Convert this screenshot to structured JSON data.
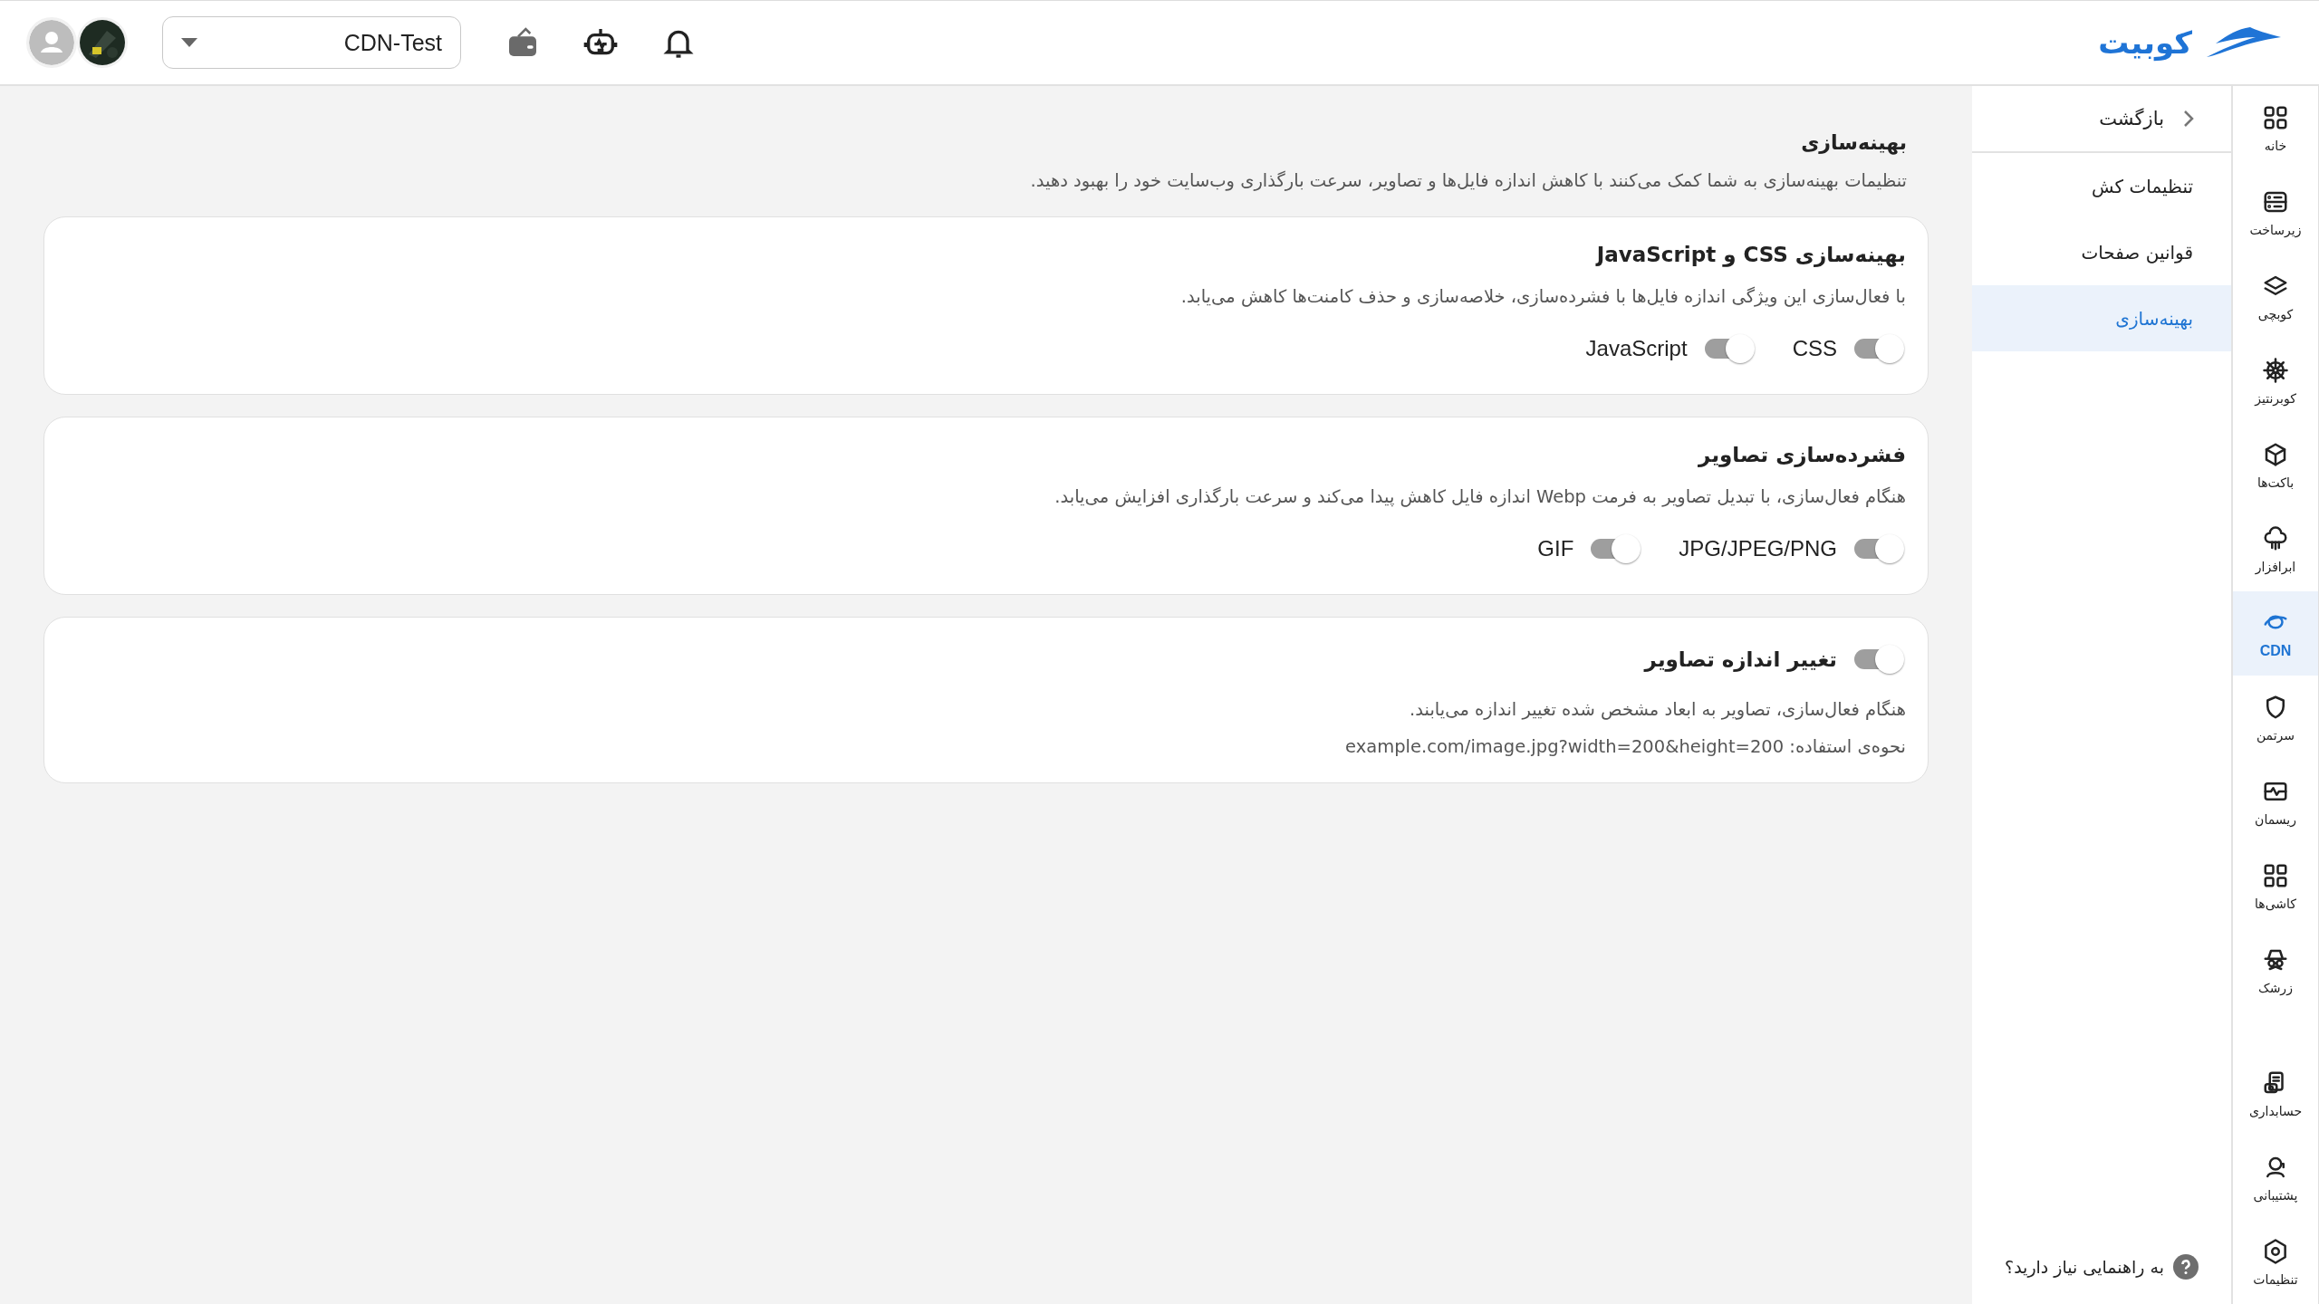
{
  "topbar": {
    "logo_text": "کوبیت",
    "project": "CDN-Test"
  },
  "rail": {
    "items": [
      {
        "label": "خانه",
        "selected": false
      },
      {
        "label": "زیرساخت",
        "selected": false
      },
      {
        "label": "کوبچی",
        "selected": false
      },
      {
        "label": "کوبرنتیز",
        "selected": false
      },
      {
        "label": "باکت‌ها",
        "selected": false
      },
      {
        "label": "ابرافزار",
        "selected": false
      },
      {
        "label": "CDN",
        "selected": true
      },
      {
        "label": "سرتمن",
        "selected": false
      },
      {
        "label": "ریسمان",
        "selected": false
      },
      {
        "label": "کاشی‌ها",
        "selected": false
      },
      {
        "label": "زرشک",
        "selected": false
      }
    ],
    "footer_items": [
      {
        "label": "حسابداری",
        "selected": false
      },
      {
        "label": "پشتیبانی",
        "selected": false
      },
      {
        "label": "تنظیمات",
        "selected": false
      }
    ]
  },
  "submenu": {
    "back": "بازگشت",
    "items": [
      {
        "label": "تنظیمات کش",
        "selected": false
      },
      {
        "label": "قوانین صفحات",
        "selected": false
      },
      {
        "label": "بهینه‌سازی",
        "selected": true
      }
    ],
    "help": "به راهنمایی نیاز دارید؟"
  },
  "page": {
    "title": "بهینه‌سازی",
    "description": "تنظیمات بهینه‌سازی به شما کمک می‌کنند با کاهش اندازه فایل‌ها و تصاویر، سرعت بارگذاری وب‌سایت خود را بهبود دهید."
  },
  "cards": [
    {
      "kind": "toggles",
      "title": "بهینه‌سازی CSS و JavaScript",
      "description": "با فعال‌سازی این ویژگی اندازه فایل‌ها با فشرده‌سازی، خلاصه‌سازی و حذف کامنت‌ها کاهش می‌یابد.",
      "toggles": [
        {
          "label": "CSS",
          "on": true
        },
        {
          "label": "JavaScript",
          "on": true
        }
      ]
    },
    {
      "kind": "toggles",
      "title": "فشرده‌سازی تصاویر",
      "description": "هنگام فعال‌سازی، با تبدیل تصاویر به فرمت Webp اندازه فایل کاهش پیدا می‌کند و سرعت بارگذاری افزایش می‌یابد.",
      "toggles": [
        {
          "label": "JPG/JPEG/PNG",
          "on": true
        },
        {
          "label": "GIF",
          "on": true
        }
      ]
    },
    {
      "kind": "switch_title",
      "title": "تغییر اندازه تصاویر",
      "on": true,
      "description": "هنگام فعال‌سازی، تصاویر به ابعاد مشخص شده تغییر اندازه می‌یابند.",
      "usage": "نحوه‌ی استفاده: example.com/image.jpg?width=200&height=200"
    }
  ]
}
